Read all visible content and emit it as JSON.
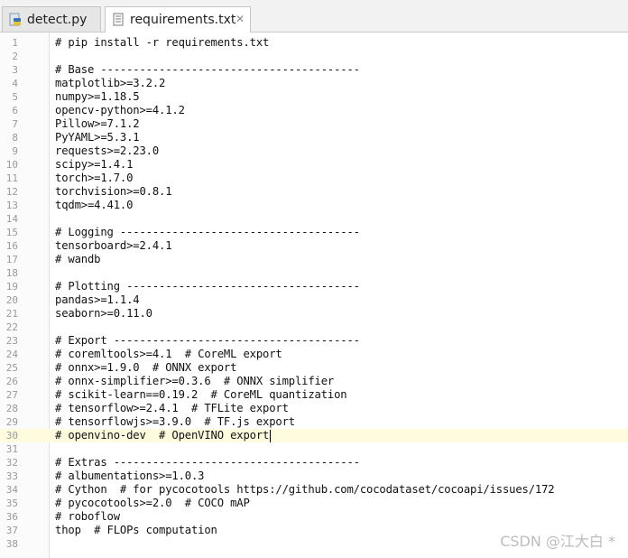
{
  "tabs": [
    {
      "label": "detect.py",
      "icon": "python-file-icon",
      "active": false
    },
    {
      "label": "requirements.txt",
      "icon": "text-file-icon",
      "active": true
    }
  ],
  "editor": {
    "caret_line": 30,
    "lines": [
      "# pip install -r requirements.txt",
      "",
      "# Base ----------------------------------------",
      "matplotlib>=3.2.2",
      "numpy>=1.18.5",
      "opencv-python>=4.1.2",
      "Pillow>=7.1.2",
      "PyYAML>=5.3.1",
      "requests>=2.23.0",
      "scipy>=1.4.1",
      "torch>=1.7.0",
      "torchvision>=0.8.1",
      "tqdm>=4.41.0",
      "",
      "# Logging -------------------------------------",
      "tensorboard>=2.4.1",
      "# wandb",
      "",
      "# Plotting ------------------------------------",
      "pandas>=1.1.4",
      "seaborn>=0.11.0",
      "",
      "# Export --------------------------------------",
      "# coremltools>=4.1  # CoreML export",
      "# onnx>=1.9.0  # ONNX export",
      "# onnx-simplifier>=0.3.6  # ONNX simplifier",
      "# scikit-learn==0.19.2  # CoreML quantization",
      "# tensorflow>=2.4.1  # TFLite export",
      "# tensorflowjs>=3.9.0  # TF.js export",
      "# openvino-dev  # OpenVINO export",
      "",
      "# Extras --------------------------------------",
      "# albumentations>=1.0.3",
      "# Cython  # for pycocotools https://github.com/cocodataset/cocoapi/issues/172",
      "# pycocotools>=2.0  # COCO mAP",
      "# roboflow",
      "thop  # FLOPs computation",
      ""
    ]
  },
  "watermark": "CSDN @江大白 *"
}
